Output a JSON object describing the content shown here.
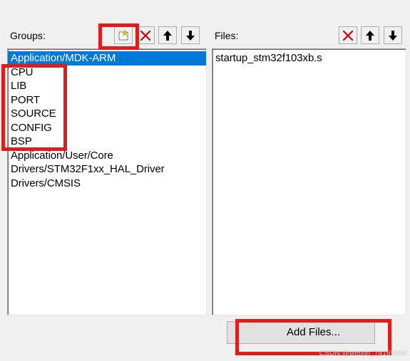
{
  "groups": {
    "label": "Groups:",
    "toolbar": {
      "new_icon": "new-group-icon",
      "delete_icon": "delete-icon",
      "up_icon": "arrow-up-icon",
      "down_icon": "arrow-down-icon"
    },
    "items": [
      {
        "label": "Application/MDK-ARM",
        "selected": true
      },
      {
        "label": "CPU"
      },
      {
        "label": "LIB"
      },
      {
        "label": "PORT"
      },
      {
        "label": "SOURCE"
      },
      {
        "label": "CONFIG"
      },
      {
        "label": "BSP"
      },
      {
        "label": "Application/User/Core"
      },
      {
        "label": "Drivers/STM32F1xx_HAL_Driver"
      },
      {
        "label": "Drivers/CMSIS"
      }
    ]
  },
  "files": {
    "label": "Files:",
    "toolbar": {
      "delete_icon": "delete-icon",
      "up_icon": "arrow-up-icon",
      "down_icon": "arrow-down-icon"
    },
    "items": [
      {
        "label": "startup_stm32f103xb.s"
      }
    ]
  },
  "add_files_label": "Add Files...",
  "watermark": "CSDN @weixin_74169950",
  "colors": {
    "selection": "#0078d7",
    "highlight_box": "#e01c1c",
    "delete_x": "#d40000"
  }
}
